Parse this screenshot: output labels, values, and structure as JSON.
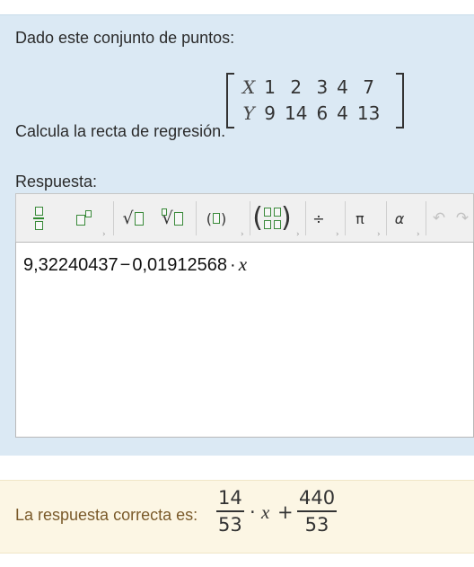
{
  "question": {
    "prompt": "Dado este conjunto de puntos:",
    "matrix": {
      "x_label": "X",
      "y_label": "Y",
      "x_values": [
        "1",
        "2",
        "3",
        "4",
        "7"
      ],
      "y_values": [
        "9",
        "14",
        "6",
        "4",
        "13"
      ]
    },
    "instruction": "Calcula la recta de regresión.",
    "answer_label": "Respuesta:"
  },
  "toolbar": {
    "sqrt_symbol": "√",
    "nthroot_symbol": "∛",
    "paren_symbol": "(□)",
    "divide_symbol": "÷",
    "pi_symbol": "π",
    "alpha_symbol": "α",
    "undo_symbol": "↶",
    "redo_symbol": "↷"
  },
  "input": {
    "coef": "9,32240437",
    "minus": "−",
    "slope": "0,01912568",
    "dot": "·",
    "var": "x"
  },
  "feedback": {
    "label": "La respuesta correcta es:",
    "slope_num": "14",
    "slope_den": "53",
    "dot": "·",
    "var": "x",
    "plus": "+",
    "intercept_num": "440",
    "intercept_den": "53"
  },
  "colors": {
    "panel_bg": "#dbe9f4",
    "feedback_bg": "#fcf6e4",
    "feedback_text": "#7a5a2a",
    "tool_icon": "#2e8b2e"
  }
}
